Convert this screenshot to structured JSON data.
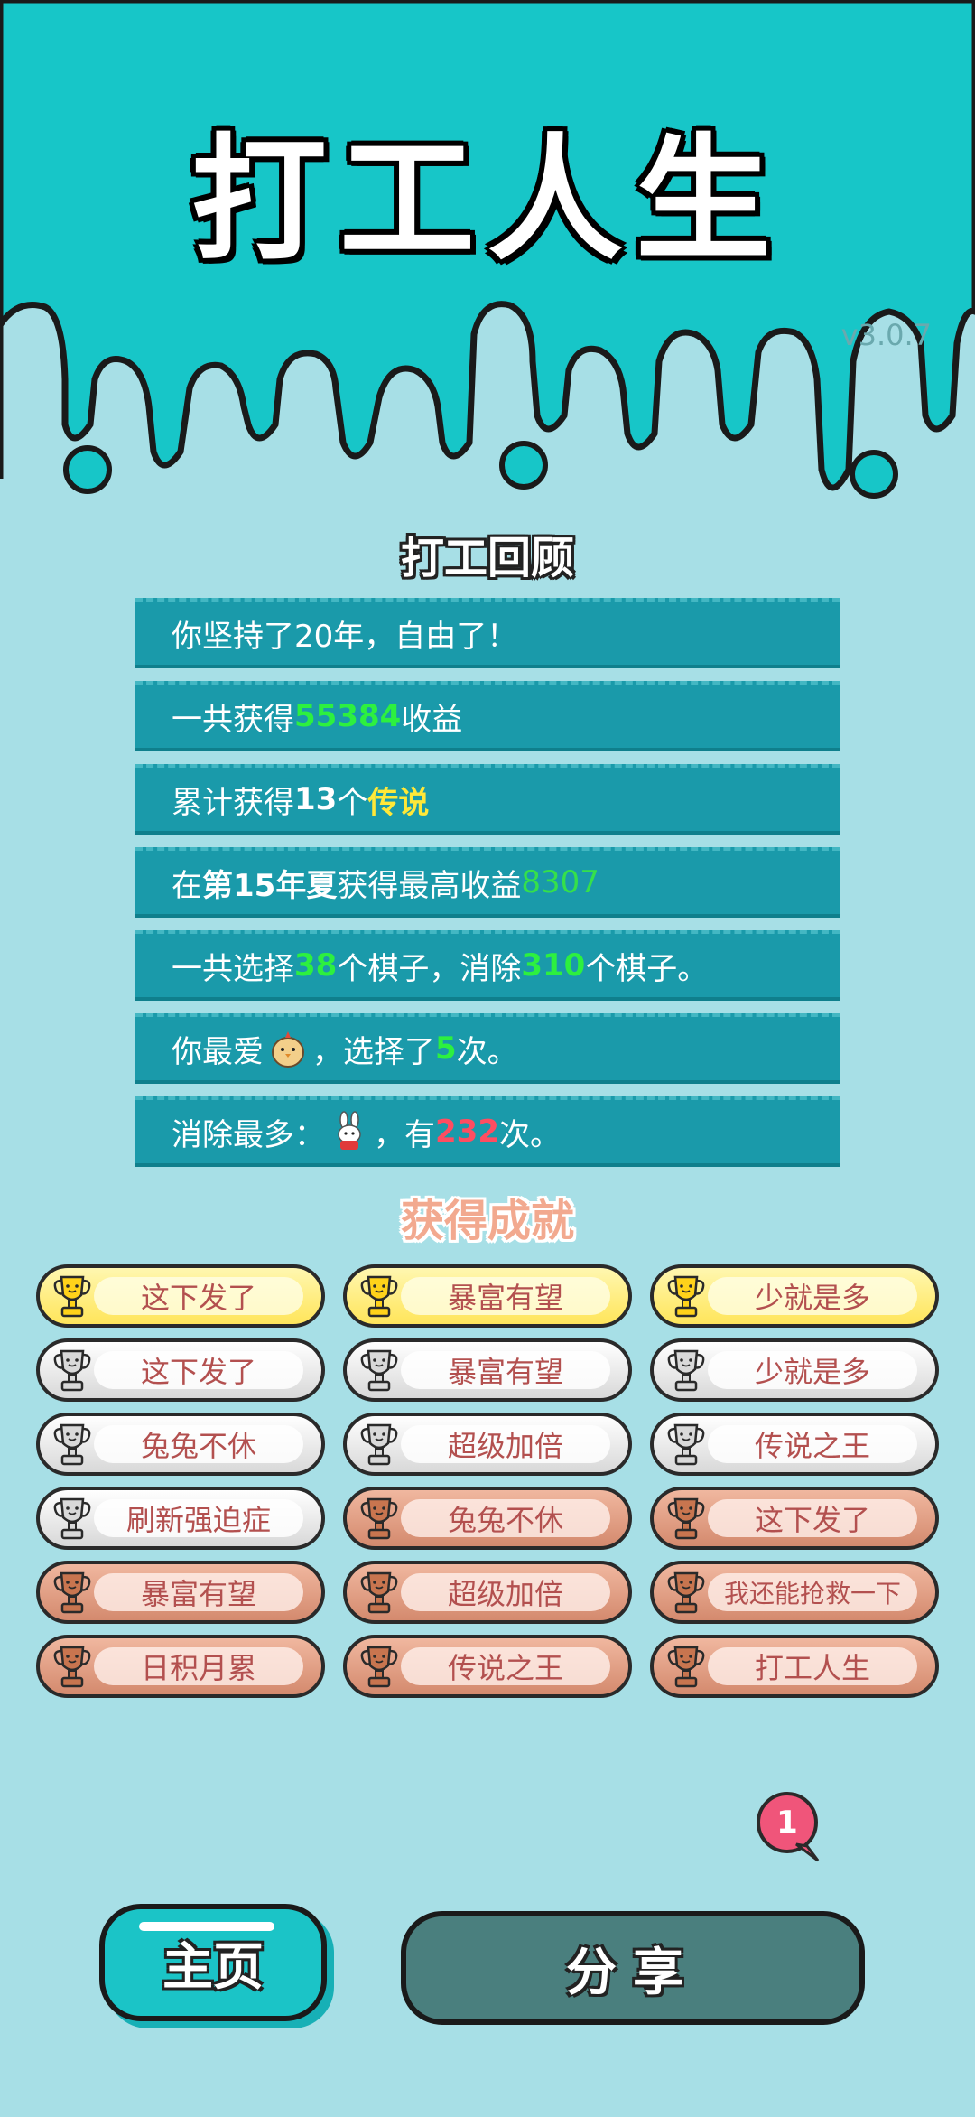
{
  "header": {
    "title": "打工人生",
    "version": "v3.0.7"
  },
  "review": {
    "heading": "打工回顾",
    "rows": [
      {
        "pre": "你坚持了20年，自由了！"
      },
      {
        "pre": "一共获得",
        "value": "55384",
        "post": "收益"
      },
      {
        "pre": "累计获得",
        "count": "13",
        "mid": "个",
        "legend": "传说"
      },
      {
        "pre": "在 ",
        "season": "第15年夏",
        "mid": " 获得最高收益",
        "value": "8307"
      },
      {
        "pre": "一共选择",
        "v1": "38",
        "mid": "个棋子，消除",
        "v2": "310",
        "post": "个棋子。"
      },
      {
        "pre": "你最爱",
        "mid": "，选择了",
        "value": "5",
        "post": "次。",
        "icon": "chick-icon"
      },
      {
        "pre": "消除最多：",
        "mid": "，有",
        "value": "232",
        "post": "次。",
        "icon": "rabbit-icon"
      }
    ]
  },
  "achievements": {
    "heading": "获得成就",
    "items": [
      {
        "label": "这下发了",
        "tier": "gold"
      },
      {
        "label": "暴富有望",
        "tier": "gold"
      },
      {
        "label": "少就是多",
        "tier": "gold"
      },
      {
        "label": "这下发了",
        "tier": "silver"
      },
      {
        "label": "暴富有望",
        "tier": "silver"
      },
      {
        "label": "少就是多",
        "tier": "silver"
      },
      {
        "label": "兔兔不休",
        "tier": "silver"
      },
      {
        "label": "超级加倍",
        "tier": "silver"
      },
      {
        "label": "传说之王",
        "tier": "silver"
      },
      {
        "label": "刷新强迫症",
        "tier": "silver"
      },
      {
        "label": "兔兔不休",
        "tier": "bronze"
      },
      {
        "label": "这下发了",
        "tier": "bronze"
      },
      {
        "label": "暴富有望",
        "tier": "bronze"
      },
      {
        "label": "超级加倍",
        "tier": "bronze"
      },
      {
        "label": "我还能抢救一下",
        "tier": "bronze"
      },
      {
        "label": "日积月累",
        "tier": "bronze"
      },
      {
        "label": "传说之王",
        "tier": "bronze"
      },
      {
        "label": "打工人生",
        "tier": "bronze"
      }
    ]
  },
  "notification": {
    "count": "1"
  },
  "buttons": {
    "home": "主页",
    "share": "分享"
  },
  "colors": {
    "background": "#a7dfe6",
    "header": "#17c6c8",
    "row": "#1a9aaa"
  }
}
